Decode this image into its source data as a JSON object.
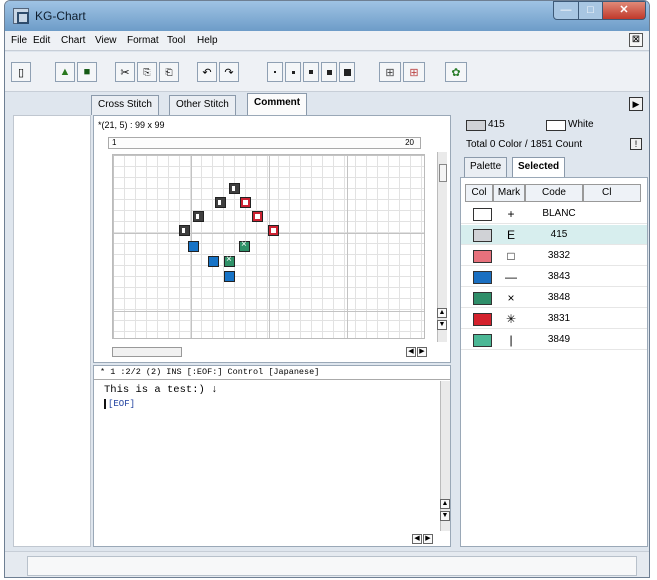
{
  "window": {
    "title": "KG-Chart"
  },
  "menu": {
    "items": [
      "File",
      "Edit",
      "Chart",
      "View",
      "Format",
      "Tool",
      "Help"
    ],
    "close_glyph": "⊠"
  },
  "tabs": [
    "Cross Stitch",
    "Other Stitch",
    "Comment"
  ],
  "chart": {
    "coord": "*(21, 5)  : 99 x 99",
    "ruler_start": "1",
    "ruler_end": "20"
  },
  "comment": {
    "status": "*       1 :2/2  (2) INS [:EOF:] Control [Japanese]",
    "text": "This is a test:) ↓",
    "eof": "[EOF]"
  },
  "palette_summary": {
    "color1": "415",
    "color2": "White",
    "total": "Total 0 Color / 1851 Count"
  },
  "palette_tabs": [
    "Palette",
    "Selected"
  ],
  "palette_headers": [
    "Col",
    "Mark",
    "Code",
    "Cl"
  ],
  "palette_rows": [
    {
      "color": "#ffffff",
      "mark": "+",
      "code": "BLANC"
    },
    {
      "color": "#d0d2d6",
      "mark": "E",
      "code": "415"
    },
    {
      "color": "#e7717c",
      "mark": "□",
      "code": "3832"
    },
    {
      "color": "#1a6fc1",
      "mark": "—",
      "code": "3843"
    },
    {
      "color": "#2f8e69",
      "mark": "×",
      "code": "3848"
    },
    {
      "color": "#d4222d",
      "mark": "✳",
      "code": "3831"
    },
    {
      "color": "#4bb795",
      "mark": "|",
      "code": "3849"
    }
  ]
}
